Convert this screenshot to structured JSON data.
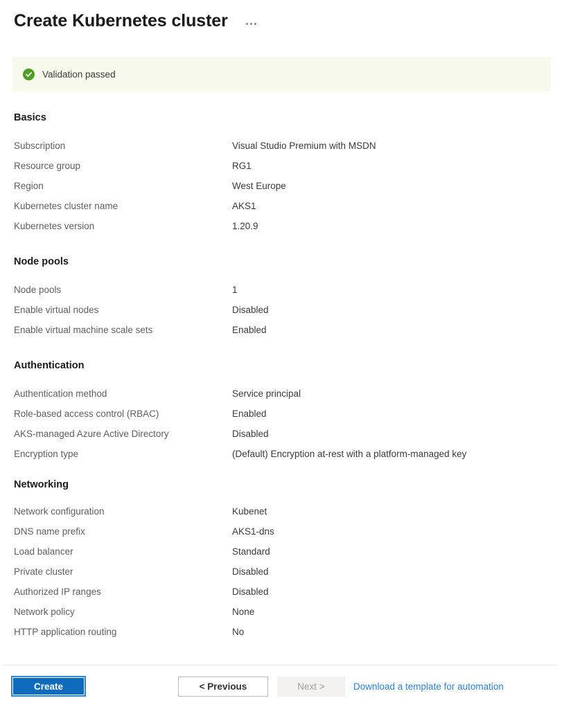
{
  "header": {
    "title": "Create Kubernetes cluster",
    "more_options_label": "..."
  },
  "validation": {
    "message": "Validation passed",
    "icon": "check-circle-icon",
    "background_color": "#f7f9ec",
    "icon_color": "#4f9d22"
  },
  "sections": [
    {
      "heading": "Basics",
      "rows": [
        {
          "label": "Subscription",
          "value": "Visual Studio Premium with MSDN"
        },
        {
          "label": "Resource group",
          "value": "RG1"
        },
        {
          "label": "Region",
          "value": "West Europe"
        },
        {
          "label": "Kubernetes cluster name",
          "value": "AKS1"
        },
        {
          "label": "Kubernetes version",
          "value": "1.20.9"
        }
      ]
    },
    {
      "heading": "Node pools",
      "rows": [
        {
          "label": "Node pools",
          "value": "1"
        },
        {
          "label": "Enable virtual nodes",
          "value": "Disabled"
        },
        {
          "label": "Enable virtual machine scale sets",
          "value": "Enabled"
        }
      ]
    },
    {
      "heading": "Authentication",
      "rows": [
        {
          "label": "Authentication method",
          "value": "Service principal"
        },
        {
          "label": "Role-based access control (RBAC)",
          "value": "Enabled"
        },
        {
          "label": "AKS-managed Azure Active Directory",
          "value": "Disabled"
        },
        {
          "label": "Encryption type",
          "value": "(Default) Encryption at-rest with a platform-managed key"
        }
      ]
    },
    {
      "heading": "Networking",
      "rows": [
        {
          "label": "Network configuration",
          "value": "Kubenet"
        },
        {
          "label": "DNS name prefix",
          "value": "AKS1-dns"
        },
        {
          "label": "Load balancer",
          "value": "Standard"
        },
        {
          "label": "Private cluster",
          "value": "Disabled"
        },
        {
          "label": "Authorized IP ranges",
          "value": "Disabled"
        },
        {
          "label": "Network policy",
          "value": "None"
        },
        {
          "label": "HTTP application routing",
          "value": "No"
        }
      ]
    }
  ],
  "footer": {
    "create_label": "Create",
    "previous_label": "< Previous",
    "next_label": "Next >",
    "download_link_label": "Download a template for automation",
    "accent_color": "#0f6cbd",
    "link_color": "#2f7fd0"
  }
}
